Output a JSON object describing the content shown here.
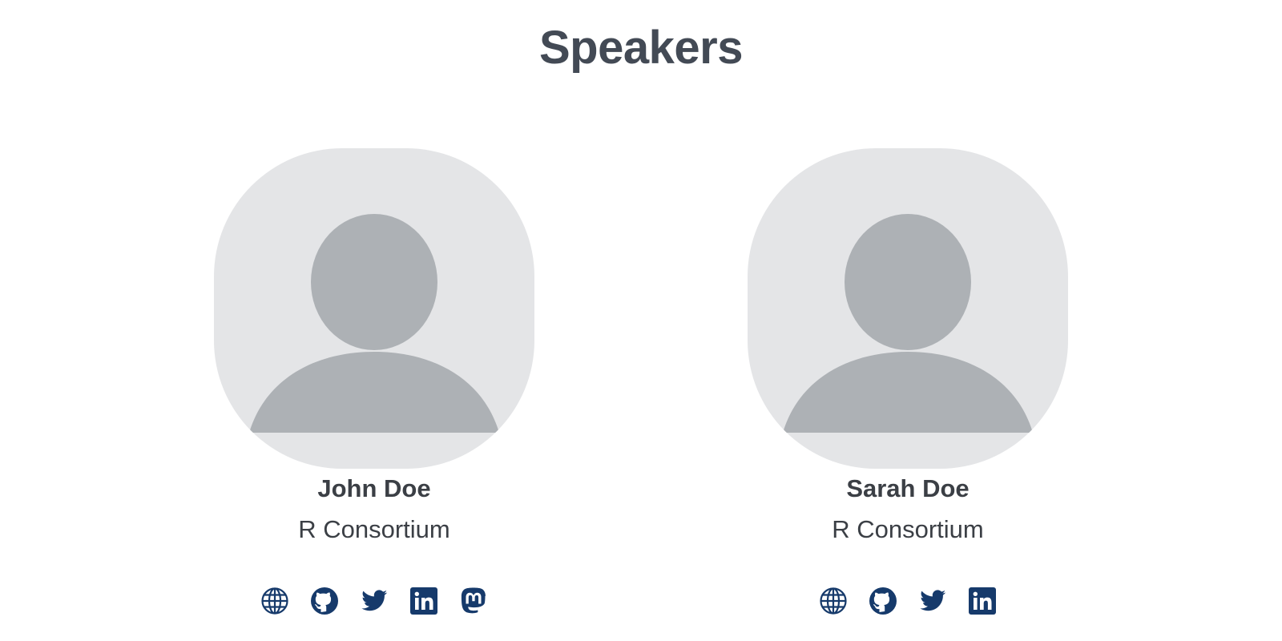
{
  "page": {
    "title": "Speakers"
  },
  "colors": {
    "icon": "#163a6b",
    "avatar_bg": "#e4e5e7",
    "avatar_fg": "#adb1b5",
    "title": "#434a55"
  },
  "speakers": [
    {
      "name": "John Doe",
      "affiliation": "R Consortium",
      "links": [
        "website-icon",
        "github-icon",
        "twitter-icon",
        "linkedin-icon",
        "mastodon-icon"
      ]
    },
    {
      "name": "Sarah Doe",
      "affiliation": "R Consortium",
      "links": [
        "website-icon",
        "github-icon",
        "twitter-icon",
        "linkedin-icon"
      ]
    }
  ]
}
